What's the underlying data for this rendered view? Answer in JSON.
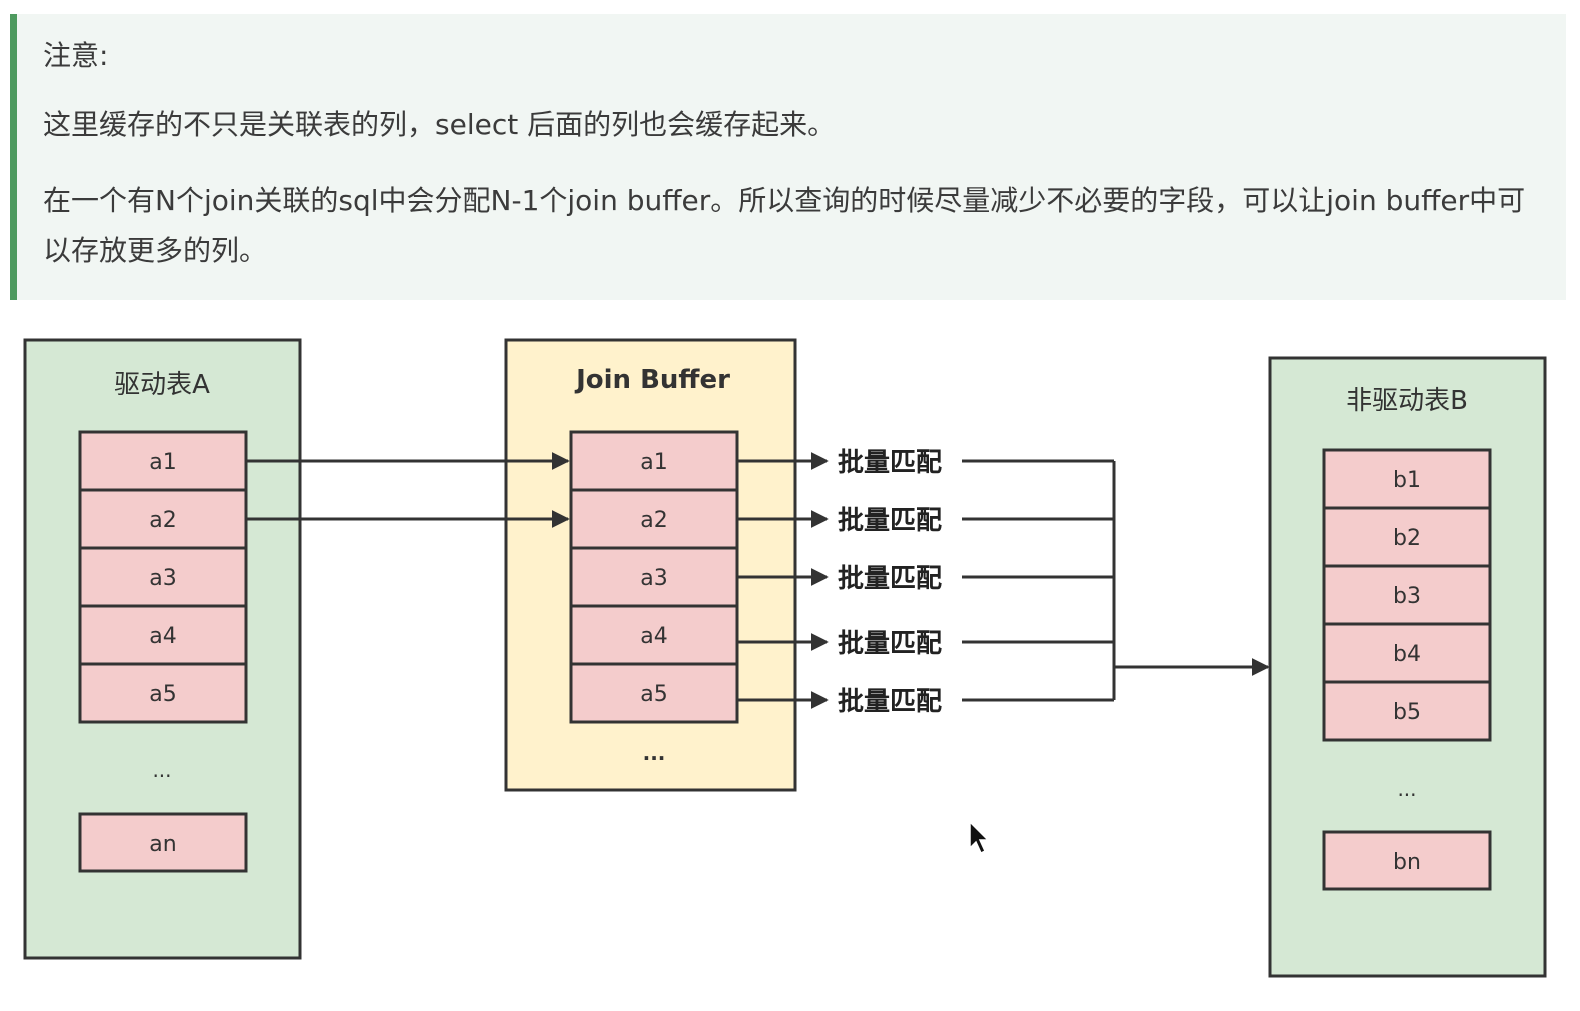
{
  "note": {
    "title": "注意:",
    "paragraph1": "这里缓存的不只是关联表的列，select 后面的列也会缓存起来。",
    "paragraph2": "在一个有N个join关联的sql中会分配N-1个join buffer。所以查询的时候尽量减少不必要的字段，可以让join buffer中可以存放更多的列。"
  },
  "diagram": {
    "table_a": {
      "title": "驱动表A",
      "rows": [
        "a1",
        "a2",
        "a3",
        "a4",
        "a5"
      ],
      "ellipsis": "...",
      "last": "an"
    },
    "join_buffer": {
      "title": "Join Buffer",
      "rows": [
        "a1",
        "a2",
        "a3",
        "a4",
        "a5"
      ],
      "ellipsis": "..."
    },
    "match_labels": [
      "批量匹配",
      "批量匹配",
      "批量匹配",
      "批量匹配",
      "批量匹配"
    ],
    "table_b": {
      "title": "非驱动表B",
      "rows": [
        "b1",
        "b2",
        "b3",
        "b4",
        "b5"
      ],
      "ellipsis": "...",
      "last": "bn"
    },
    "colors": {
      "table_bg": "#d5e8d4",
      "buffer_bg": "#fff2cc",
      "row_bg": "#f4cccc",
      "stroke": "#333333",
      "note_bg": "#f1f6f3",
      "note_accent": "#4e9a5f"
    }
  }
}
